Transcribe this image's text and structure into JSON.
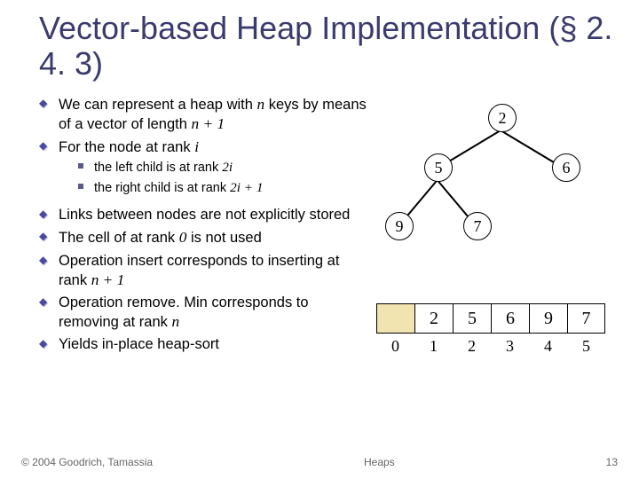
{
  "title": "Vector-based Heap Implementation (§ 2. 4. 3)",
  "bullets": {
    "b1a": "We can represent a heap with ",
    "b1b": " keys by means of a vector of length ",
    "b2a": "For the node at rank ",
    "s1a": "the left child is at rank ",
    "s2a": "the right child is at rank ",
    "b3": "Links between nodes are not explicitly stored",
    "b4a": "The cell of at rank ",
    "b4b": " is not used",
    "b5a": "Operation insert corresponds to inserting at rank ",
    "b6a": "Operation remove. Min corresponds to removing at rank ",
    "b7": "Yields in-place heap-sort"
  },
  "math": {
    "n": "n",
    "np1": "n + 1",
    "i": "i",
    "two_i": "2i",
    "two_i_p1": "2i + 1",
    "zero": "0"
  },
  "tree": {
    "n1": "2",
    "n2": "5",
    "n3": "6",
    "n4": "9",
    "n5": "7"
  },
  "array_values": [
    "",
    "2",
    "5",
    "6",
    "9",
    "7"
  ],
  "array_indices": [
    "0",
    "1",
    "2",
    "3",
    "4",
    "5"
  ],
  "footer": {
    "copyright": "© 2004 Goodrich, Tamassia",
    "center": "Heaps",
    "page": "13"
  }
}
